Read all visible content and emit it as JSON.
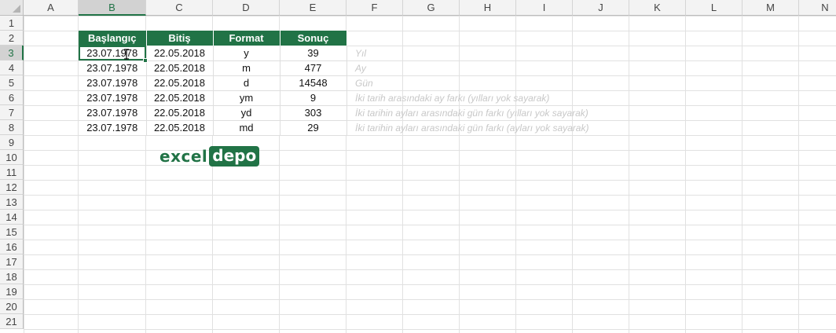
{
  "columns": [
    "A",
    "B",
    "C",
    "D",
    "E",
    "F",
    "G",
    "H",
    "I",
    "J",
    "K",
    "L",
    "M",
    "N"
  ],
  "rows": [
    "1",
    "2",
    "3",
    "4",
    "5",
    "6",
    "7",
    "8",
    "9",
    "10",
    "11",
    "12",
    "13",
    "14",
    "15",
    "16",
    "17",
    "18",
    "19",
    "20",
    "21"
  ],
  "selected": {
    "column": "B",
    "row": "3"
  },
  "table": {
    "headers": [
      "Başlangıç",
      "Bitiş",
      "Format",
      "Sonuç"
    ],
    "rows": [
      [
        "23.07.1978",
        "22.05.2018",
        "y",
        "39"
      ],
      [
        "23.07.1978",
        "22.05.2018",
        "m",
        "477"
      ],
      [
        "23.07.1978",
        "22.05.2018",
        "d",
        "14548"
      ],
      [
        "23.07.1978",
        "22.05.2018",
        "ym",
        "9"
      ],
      [
        "23.07.1978",
        "22.05.2018",
        "yd",
        "303"
      ],
      [
        "23.07.1978",
        "22.05.2018",
        "md",
        "29"
      ]
    ]
  },
  "notes": [
    "Yıl",
    "Ay",
    "Gün",
    "İki tarih arasındaki ay farkı (yılları yok sayarak)",
    "İki tarihin ayları arasındaki gün farkı (yılları yok sayarak)",
    "İki tarihin ayları arasındaki gün farkı (ayları yok sayarak)"
  ],
  "logo": {
    "part1": "excel",
    "part2": "depo"
  },
  "colors": {
    "accent": "#217346",
    "note": "#c8c8c8"
  }
}
